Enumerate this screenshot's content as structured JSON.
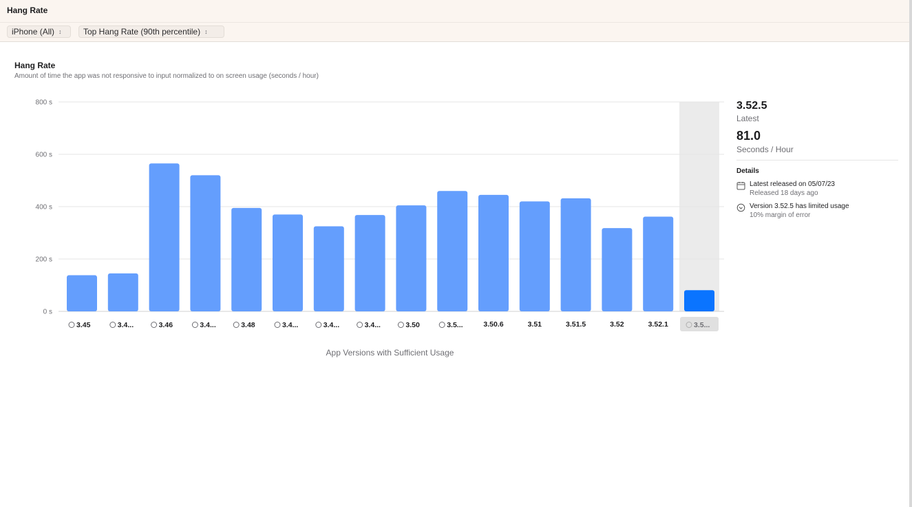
{
  "app": {
    "title": "Hang Rate"
  },
  "filters": {
    "device": "iPhone (All)",
    "metric": "Top Hang Rate (90th percentile)"
  },
  "chart_header": {
    "title": "Hang Rate",
    "subtitle": "Amount of time the app was not responsive to input normalized to on screen usage (seconds / hour)"
  },
  "chart_data": {
    "type": "bar",
    "y_ticks": [
      "800 s",
      "600 s",
      "400 s",
      "200 s",
      "0 s"
    ],
    "ylim": [
      0,
      800
    ],
    "grid": true,
    "xlabel": "App Versions with Sufficient Usage",
    "categories": [
      {
        "label": "3.45",
        "icon": true
      },
      {
        "label": "3.4...",
        "icon": true
      },
      {
        "label": "3.46",
        "icon": true
      },
      {
        "label": "3.4...",
        "icon": true
      },
      {
        "label": "3.48",
        "icon": true
      },
      {
        "label": "3.4...",
        "icon": true
      },
      {
        "label": "3.4...",
        "icon": true
      },
      {
        "label": "3.4...",
        "icon": true
      },
      {
        "label": "3.50",
        "icon": true
      },
      {
        "label": "3.5...",
        "icon": true
      },
      {
        "label": "3.50.6",
        "icon": false
      },
      {
        "label": "3.51",
        "icon": false
      },
      {
        "label": "3.51.5",
        "icon": false
      },
      {
        "label": "3.52",
        "icon": false
      },
      {
        "label": "3.52.1",
        "icon": false
      },
      {
        "label": "3.5...",
        "icon": true
      }
    ],
    "values": [
      138,
      145,
      565,
      520,
      395,
      370,
      325,
      368,
      405,
      460,
      445,
      420,
      432,
      318,
      362,
      81
    ],
    "selected_index": 15,
    "colors": {
      "bar": "#649efd",
      "selected": "#0a74ff",
      "highlight": "#ebebeb"
    }
  },
  "summary": {
    "latest_version": "3.52.5",
    "latest_label": "Latest",
    "value": "81.0",
    "unit": "Seconds / Hour",
    "details_heading": "Details",
    "released": "Latest released on 05/07/23",
    "released_ago": "Released 18 days ago",
    "usage_note": "Version 3.52.5 has limited usage",
    "margin": "10% margin of error"
  },
  "icons": {
    "popup_chevron": "chevron-updown-icon",
    "calendar": "calendar-icon",
    "limited": "limited-usage-icon"
  }
}
